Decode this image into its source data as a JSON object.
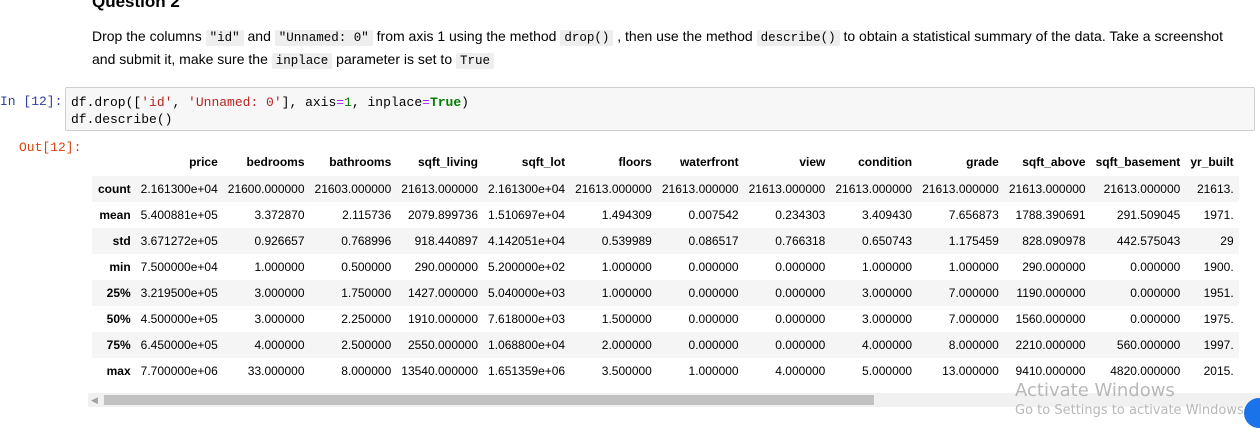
{
  "markdown": {
    "heading": "Question 2",
    "parts": [
      {
        "t": "Drop the columns "
      },
      {
        "c": "\"id\""
      },
      {
        "t": " and "
      },
      {
        "c": "\"Unnamed: 0\""
      },
      {
        "t": " from axis 1 using the method "
      },
      {
        "c": "drop()"
      },
      {
        "t": " , then use the method "
      },
      {
        "c": "describe()"
      },
      {
        "t": " to obtain a statistical summary of the data. Take a screenshot and submit it, make sure the "
      },
      {
        "c": "inplace"
      },
      {
        "t": " parameter is set to "
      },
      {
        "c": "True"
      }
    ]
  },
  "cell": {
    "in_prompt": "In [12]:",
    "out_prompt": "Out[12]:",
    "code_lines": [
      [
        {
          "t": "df.drop(["
        },
        {
          "s": "'id'"
        },
        {
          "t": ", "
        },
        {
          "s": "'Unnamed: 0'"
        },
        {
          "t": "], axis"
        },
        {
          "o": "="
        },
        {
          "n": "1"
        },
        {
          "t": ", inplace"
        },
        {
          "o": "="
        },
        {
          "k": "True"
        },
        {
          "t": ")"
        }
      ],
      [
        {
          "t": "df.describe()"
        }
      ]
    ]
  },
  "table": {
    "columns": [
      "price",
      "bedrooms",
      "bathrooms",
      "sqft_living",
      "sqft_lot",
      "floors",
      "waterfront",
      "view",
      "condition",
      "grade",
      "sqft_above",
      "sqft_basement",
      "yr_built"
    ],
    "rows": [
      {
        "label": "count",
        "values": [
          "2.161300e+04",
          "21600.000000",
          "21603.000000",
          "21613.000000",
          "2.161300e+04",
          "21613.000000",
          "21613.000000",
          "21613.000000",
          "21613.000000",
          "21613.000000",
          "21613.000000",
          "21613.000000",
          "21613."
        ]
      },
      {
        "label": "mean",
        "values": [
          "5.400881e+05",
          "3.372870",
          "2.115736",
          "2079.899736",
          "1.510697e+04",
          "1.494309",
          "0.007542",
          "0.234303",
          "3.409430",
          "7.656873",
          "1788.390691",
          "291.509045",
          "1971."
        ]
      },
      {
        "label": "std",
        "values": [
          "3.671272e+05",
          "0.926657",
          "0.768996",
          "918.440897",
          "4.142051e+04",
          "0.539989",
          "0.086517",
          "0.766318",
          "0.650743",
          "1.175459",
          "828.090978",
          "442.575043",
          "29"
        ]
      },
      {
        "label": "min",
        "values": [
          "7.500000e+04",
          "1.000000",
          "0.500000",
          "290.000000",
          "5.200000e+02",
          "1.000000",
          "0.000000",
          "0.000000",
          "1.000000",
          "1.000000",
          "290.000000",
          "0.000000",
          "1900."
        ]
      },
      {
        "label": "25%",
        "values": [
          "3.219500e+05",
          "3.000000",
          "1.750000",
          "1427.000000",
          "5.040000e+03",
          "1.000000",
          "0.000000",
          "0.000000",
          "3.000000",
          "7.000000",
          "1190.000000",
          "0.000000",
          "1951."
        ]
      },
      {
        "label": "50%",
        "values": [
          "4.500000e+05",
          "3.000000",
          "2.250000",
          "1910.000000",
          "7.618000e+03",
          "1.500000",
          "0.000000",
          "0.000000",
          "3.000000",
          "7.000000",
          "1560.000000",
          "0.000000",
          "1975."
        ]
      },
      {
        "label": "75%",
        "values": [
          "6.450000e+05",
          "4.000000",
          "2.500000",
          "2550.000000",
          "1.068800e+04",
          "2.000000",
          "0.000000",
          "0.000000",
          "4.000000",
          "8.000000",
          "2210.000000",
          "560.000000",
          "1997."
        ]
      },
      {
        "label": "max",
        "values": [
          "7.700000e+06",
          "33.000000",
          "8.000000",
          "13540.000000",
          "1.651359e+06",
          "3.500000",
          "1.000000",
          "4.000000",
          "5.000000",
          "13.000000",
          "9410.000000",
          "4820.000000",
          "2015."
        ]
      }
    ]
  },
  "scrollbar": {
    "left_arrow": "◀"
  },
  "watermark": {
    "title": "Activate Windows",
    "subtitle": "Go to Settings to activate Windows."
  },
  "colors": {
    "in_prompt": "#303f9f",
    "out_prompt": "#d84315",
    "string": "#ba2121",
    "keyword": "#008000"
  }
}
